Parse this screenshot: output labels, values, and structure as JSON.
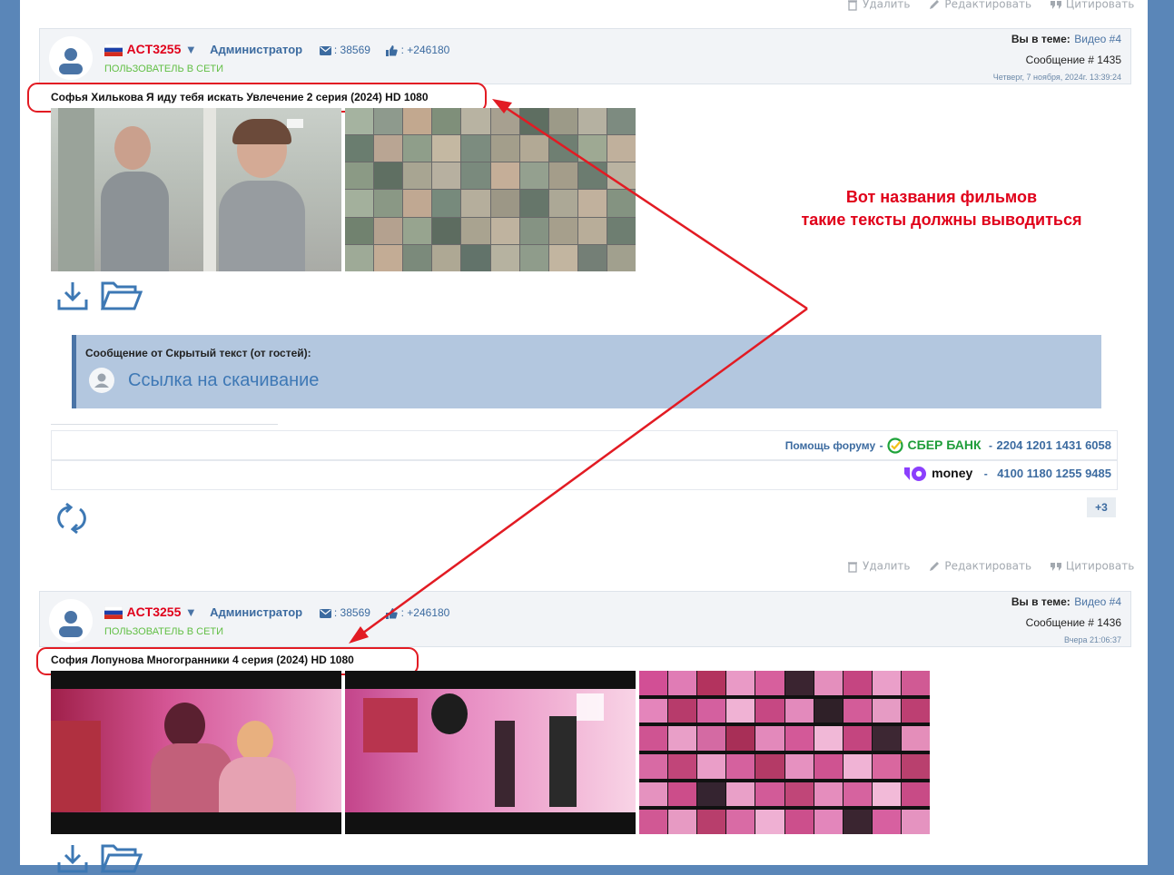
{
  "actions": {
    "delete": "Удалить",
    "edit": "Редактировать",
    "quote": "Цитировать"
  },
  "posts": [
    {
      "username": "ACT3255",
      "role": "Администратор",
      "messages": ": 38569",
      "likes": ": +246180",
      "status": "ПОЛЬЗОВАТЕЛЬ В СЕТИ",
      "topic_label": "Вы в теме:",
      "topic_link": "Видео #4",
      "message_number": "Сообщение # 1435",
      "date": "Четверг, 7 ноября, 2024г. 13:39:24",
      "title": "Софья Хилькова Я иду тебя искать Увлечение 2 серия (2024) HD 1080"
    },
    {
      "username": "ACT3255",
      "role": "Администратор",
      "messages": ": 38569",
      "likes": ": +246180",
      "status": "ПОЛЬЗОВАТЕЛЬ В СЕТИ",
      "topic_label": "Вы в теме:",
      "topic_link": "Видео #4",
      "message_number": "Сообщение # 1436",
      "date": "Вчера 21:06:37",
      "title": "София Лопунова Многогранники 4 серия (2024) HD 1080"
    }
  ],
  "hidden_block": {
    "header": "Сообщение от Скрытый текст (от гостей):",
    "link": "Ссылка на скачивание"
  },
  "donate": {
    "help_label": "Помощь форуму",
    "sep1": "-",
    "sber_name": "СБЕР БАНК",
    "sep2": "-",
    "sber_number": "2204 1201 1431 6058",
    "money_name": "money",
    "sep3": "-",
    "money_number": "4100 1180 1255 9485"
  },
  "reputation": "+3",
  "annotation": {
    "line1": "Вот названия фильмов",
    "line2": "такие тексты должны выводиться"
  },
  "colors": {
    "accent": "#e0001a",
    "link": "#3c6ba0",
    "online": "#62bf45",
    "annotation": "#e21b23"
  },
  "icons": [
    "trash-icon",
    "pencil-icon",
    "quote-icon",
    "mail-icon",
    "thumbs-up-icon",
    "download-icon",
    "folder-icon",
    "refresh-icon",
    "avatar-icon",
    "russia-flag-icon",
    "sber-logo-icon",
    "yoomoney-logo-icon"
  ]
}
